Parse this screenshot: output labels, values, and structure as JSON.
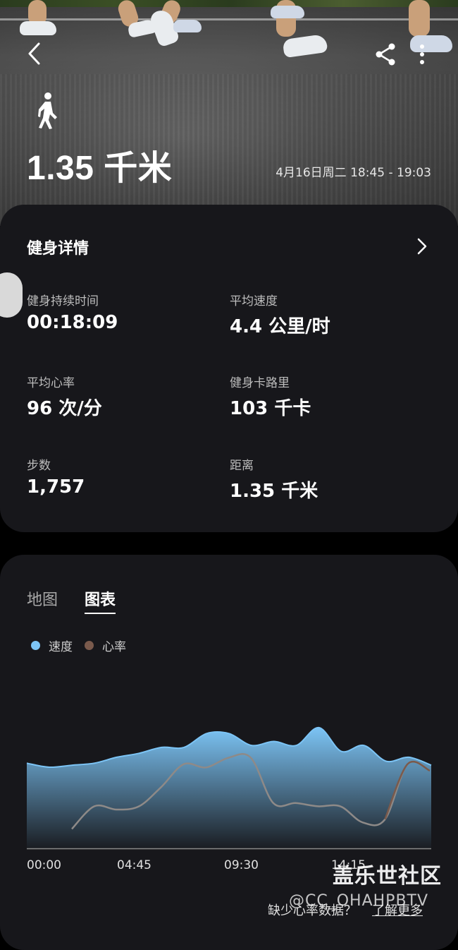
{
  "header": {
    "distance_title": "1.35 千米",
    "date_range": "4月16日周二 18:45 - 19:03",
    "activity_icon": "walk-icon",
    "back_icon": "back-arrow-icon",
    "share_icon": "share-icon",
    "more_icon": "more-vertical-icon"
  },
  "details": {
    "title": "健身详情",
    "stats": [
      {
        "label": "健身持续时间",
        "value": "00:18:09"
      },
      {
        "label": "平均速度",
        "value": "4.4 公里/时"
      },
      {
        "label": "平均心率",
        "value": "96 次/分"
      },
      {
        "label": "健身卡路里",
        "value": "103 千卡"
      },
      {
        "label": "步数",
        "value": "1,757"
      },
      {
        "label": "距离",
        "value": "1.35 千米"
      }
    ]
  },
  "chart_section": {
    "tabs": [
      {
        "label": "地图",
        "active": false
      },
      {
        "label": "图表",
        "active": true
      }
    ],
    "footer_question": "缺少心率数据？",
    "footer_link": "了解更多"
  },
  "watermark": {
    "cn": "盖乐世社区",
    "en": "@CC_OHAHPBTV"
  },
  "colors": {
    "speed": "#7cc4f5",
    "heart_rate": "#7a5a4c",
    "card_bg": "#17171b"
  },
  "chart_data": {
    "type": "area",
    "x_tick_labels": [
      "00:00",
      "04:45",
      "09:30",
      "14:15",
      ""
    ],
    "x": [
      0,
      1,
      2,
      3,
      4,
      5,
      6,
      7,
      8,
      9,
      10,
      11,
      12,
      13,
      14,
      15,
      16,
      17,
      18,
      19,
      20,
      21,
      22,
      23,
      24
    ],
    "series": [
      {
        "name": "速度",
        "color": "#7cc4f5",
        "values": [
          4.3,
          4.1,
          4.2,
          4.3,
          4.6,
          4.8,
          5.1,
          5.1,
          5.8,
          5.8,
          5.2,
          5.4,
          5.2,
          6.1,
          4.9,
          5.2,
          4.4,
          4.6,
          4.2
        ]
      },
      {
        "name": "心率",
        "color": "#7a5a4c",
        "start_index": 3,
        "values": [
          72,
          86,
          84,
          86,
          98,
          112,
          110,
          116,
          116,
          88,
          88,
          86,
          86,
          76,
          78,
          112,
          108
        ]
      }
    ],
    "legend_position": "top-left",
    "grid": false
  }
}
